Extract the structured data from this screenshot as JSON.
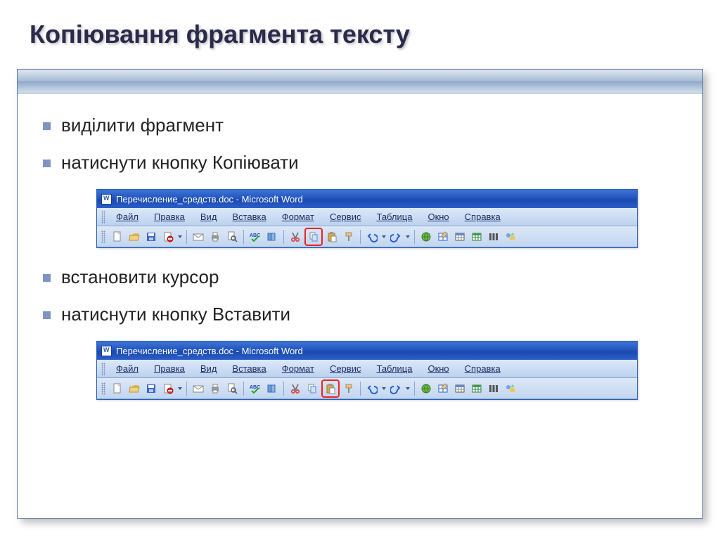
{
  "title": "Копіювання фрагмента тексту",
  "bullets": [
    "виділити фрагмент",
    "натиснути кнопку Копіювати",
    "встановити курсор",
    "натиснути кнопку Вставити"
  ],
  "word": {
    "titlebar": "Перечисление_средств.doc - Microsoft Word",
    "menus": [
      "Файл",
      "Правка",
      "Вид",
      "Вставка",
      "Формат",
      "Сервис",
      "Таблица",
      "Окно",
      "Справка"
    ],
    "toolbar_icons": [
      "new",
      "open",
      "save",
      "permission",
      "email",
      "print",
      "preview",
      "spelling",
      "research",
      "cut",
      "copy",
      "paste",
      "format-painter",
      "undo",
      "redo",
      "hyperlink",
      "tables-borders",
      "insert-table",
      "insert-excel",
      "columns",
      "drawing"
    ],
    "highlighted_copy": "copy",
    "highlighted_paste": "paste"
  }
}
